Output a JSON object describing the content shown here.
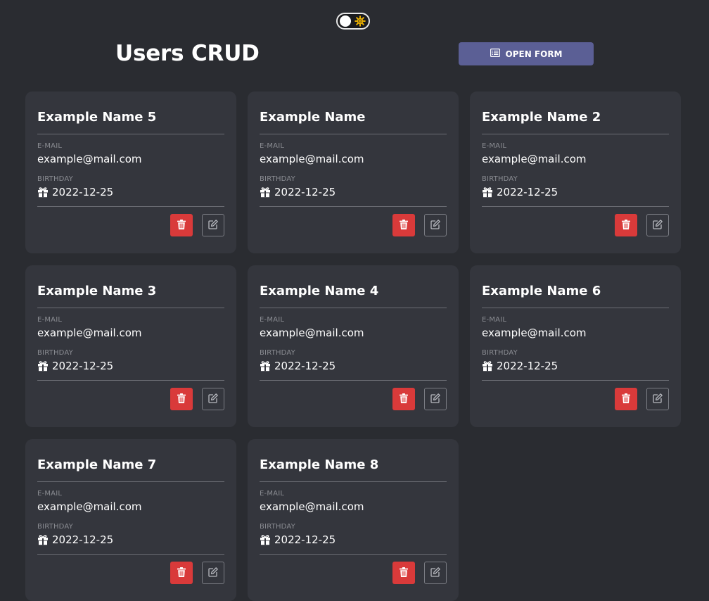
{
  "header": {
    "title": "Users CRUD",
    "open_form_label": "OPEN FORM"
  },
  "theme_toggle": {
    "state": "dark",
    "icon": "gear-icon",
    "accent": "#f0b400"
  },
  "colors": {
    "background": "#2a2c31",
    "card": "#34363d",
    "primary_button": "#5b5f95",
    "delete_button": "#d93a3a"
  },
  "labels": {
    "email": "E-MAIL",
    "birthday": "BIRTHDAY"
  },
  "users": [
    {
      "name": "Example Name 5",
      "email": "example@mail.com",
      "birthday": "2022-12-25"
    },
    {
      "name": "Example Name",
      "email": "example@mail.com",
      "birthday": "2022-12-25"
    },
    {
      "name": "Example Name 2",
      "email": "example@mail.com",
      "birthday": "2022-12-25"
    },
    {
      "name": "Example Name 3",
      "email": "example@mail.com",
      "birthday": "2022-12-25"
    },
    {
      "name": "Example Name 4",
      "email": "example@mail.com",
      "birthday": "2022-12-25"
    },
    {
      "name": "Example Name 6",
      "email": "example@mail.com",
      "birthday": "2022-12-25"
    },
    {
      "name": "Example Name 7",
      "email": "example@mail.com",
      "birthday": "2022-12-25"
    },
    {
      "name": "Example Name 8",
      "email": "example@mail.com",
      "birthday": "2022-12-25"
    }
  ]
}
